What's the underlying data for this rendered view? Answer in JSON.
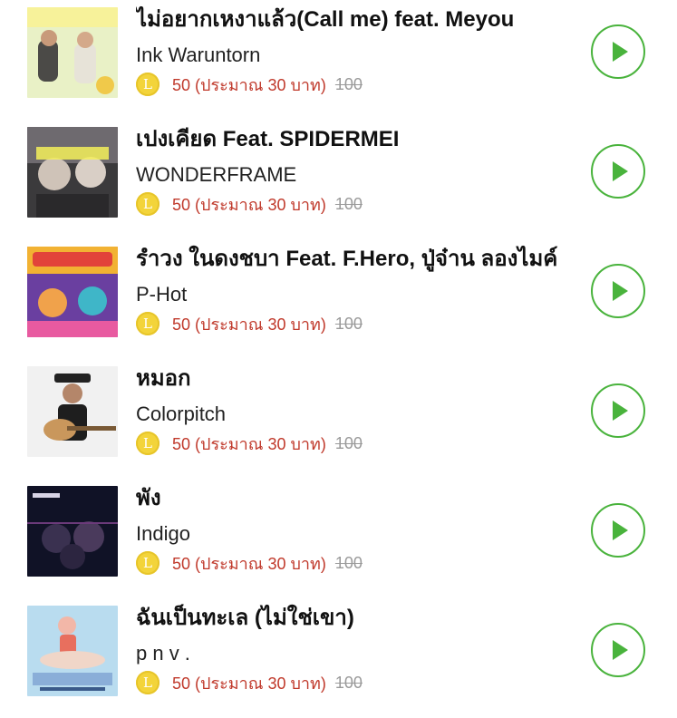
{
  "items": [
    {
      "title": "ไม่อยากเหงาแล้ว(Call me) feat. Meyou",
      "artist": "Ink Waruntorn",
      "coin": "L",
      "price": "50 (ประมาณ 30 บาท)",
      "old_price": "100"
    },
    {
      "title": "เปงเคียด Feat. SPIDERMEI",
      "artist": "WONDERFRAME",
      "coin": "L",
      "price": "50 (ประมาณ 30 บาท)",
      "old_price": "100"
    },
    {
      "title": "รำวง ในดงชบา Feat. F.Hero, ปู่จ๋าน ลองไมค์",
      "artist": "P-Hot",
      "coin": "L",
      "price": "50 (ประมาณ 30 บาท)",
      "old_price": "100"
    },
    {
      "title": "หมอก",
      "artist": "Colorpitch",
      "coin": "L",
      "price": "50 (ประมาณ 30 บาท)",
      "old_price": "100"
    },
    {
      "title": "พัง",
      "artist": "Indigo",
      "coin": "L",
      "price": "50 (ประมาณ 30 บาท)",
      "old_price": "100"
    },
    {
      "title": "ฉันเป็นทะเล (ไม่ใช่เขา)",
      "artist": "p n v .",
      "coin": "L",
      "price": "50 (ประมาณ 30 บาท)",
      "old_price": "100"
    }
  ],
  "colors": {
    "accent": "#49b33c",
    "price": "#c0392b",
    "coin": "#f3d43a"
  }
}
